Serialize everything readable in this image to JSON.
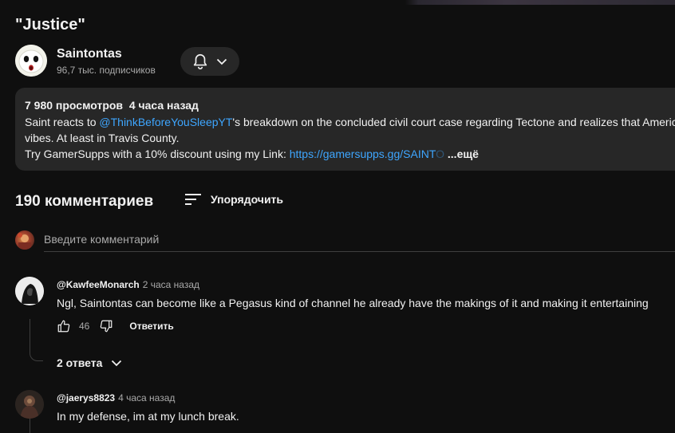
{
  "video": {
    "title": "\"Justice\""
  },
  "channel": {
    "name": "Saintontas",
    "subscribers": "96,7 тыс. подписчиков",
    "avatar_icon": "ghost-face-avatar"
  },
  "subscribe_control": {
    "bell_icon": "bell-icon",
    "chevron_icon": "chevron-down-icon"
  },
  "description": {
    "views": "7 980 просмотров",
    "published": "4 часа назад",
    "line1_prefix": "Saint reacts to ",
    "line1_mention": "@ThinkBeforeYouSleepYT",
    "line1_suffix": "'s breakdown on the concluded civil court case regarding Tectone and realizes that America is no longer",
    "line2": "vibes. At least in Travis County.",
    "line3_prefix": "Try GamerSupps with a 10% discount using my Link: ",
    "line3_link": "https://gamersupps.gg/SAINT",
    "line3_link_fade": "O",
    "more_label": "...ещё"
  },
  "comments": {
    "count_label": "190 комментариев",
    "sort_label": "Упорядочить",
    "sort_icon": "sort-icon",
    "input_placeholder": "Введите комментарий",
    "items": [
      {
        "author": "@KawfeeMonarch",
        "time": "2 часа назад",
        "text": "Ngl, Saintontas can become like a Pegasus kind of channel he already have the makings of it and making it entertaining",
        "likes": "46",
        "reply_label": "Ответить",
        "replies_label": "2 ответа"
      },
      {
        "author": "@jaerys8823",
        "time": "4 часа назад",
        "text": "In my defense, im at my lunch break."
      }
    ]
  },
  "colors": {
    "background": "#0f0f0f",
    "surface": "#272727",
    "link": "#3ea6ff",
    "text_primary": "#f1f1f1",
    "text_secondary": "#aaaaaa"
  }
}
